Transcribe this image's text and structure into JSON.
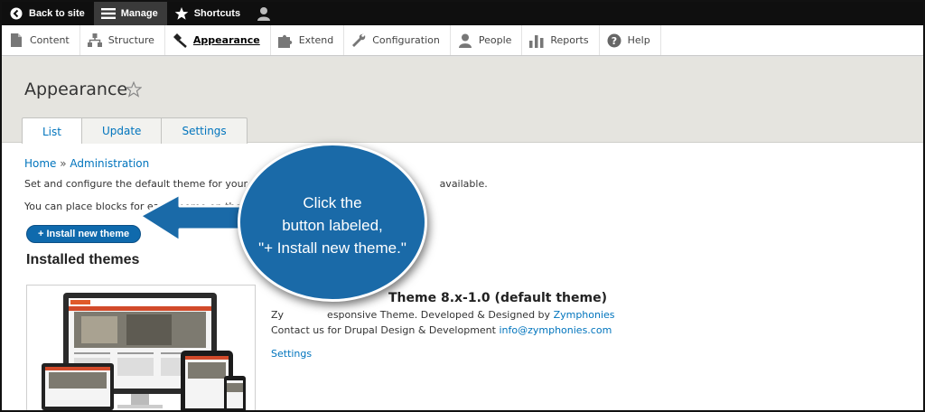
{
  "toolbar": {
    "back_label": "Back to site",
    "manage_label": "Manage",
    "shortcuts_label": "Shortcuts"
  },
  "tray": {
    "items": [
      {
        "label": "Content",
        "icon": "content-icon"
      },
      {
        "label": "Structure",
        "icon": "structure-icon"
      },
      {
        "label": "Appearance",
        "icon": "appearance-icon"
      },
      {
        "label": "Extend",
        "icon": "extend-icon"
      },
      {
        "label": "Configuration",
        "icon": "configuration-icon"
      },
      {
        "label": "People",
        "icon": "people-icon"
      },
      {
        "label": "Reports",
        "icon": "reports-icon"
      },
      {
        "label": "Help",
        "icon": "help-icon"
      }
    ]
  },
  "header": {
    "title": "Appearance",
    "tabs": [
      "List",
      "Update",
      "Settings"
    ]
  },
  "content": {
    "breadcrumb": {
      "home": "Home",
      "sep": " » ",
      "admin": "Administration"
    },
    "desc1_start": "Set and configure the default theme for your w",
    "desc1_end": "available.",
    "desc2": "You can place blocks for each theme on the",
    "install_button": "+ Install new theme",
    "installed_title": "Installed themes",
    "theme_name": "Theme 8.x-1.0 (default theme)",
    "theme_desc1_start": "Zy",
    "theme_desc1_mid": "esponsive Theme. Developed & Designed by",
    "theme_desc1_link": "Zymphonies",
    "theme_desc2_start": "Contact us for Drupal Design & Development",
    "theme_desc2_link": "info@zymphonies.com",
    "settings_link": "Settings"
  },
  "callout": {
    "line1": "Click the",
    "line2": "button labeled,",
    "line3": "\"+ Install new theme.\""
  },
  "colors": {
    "accent": "#0074bd",
    "callout": "#1a6aa8",
    "toolbar": "#0f0f0f",
    "header_bg": "#e5e4df"
  }
}
